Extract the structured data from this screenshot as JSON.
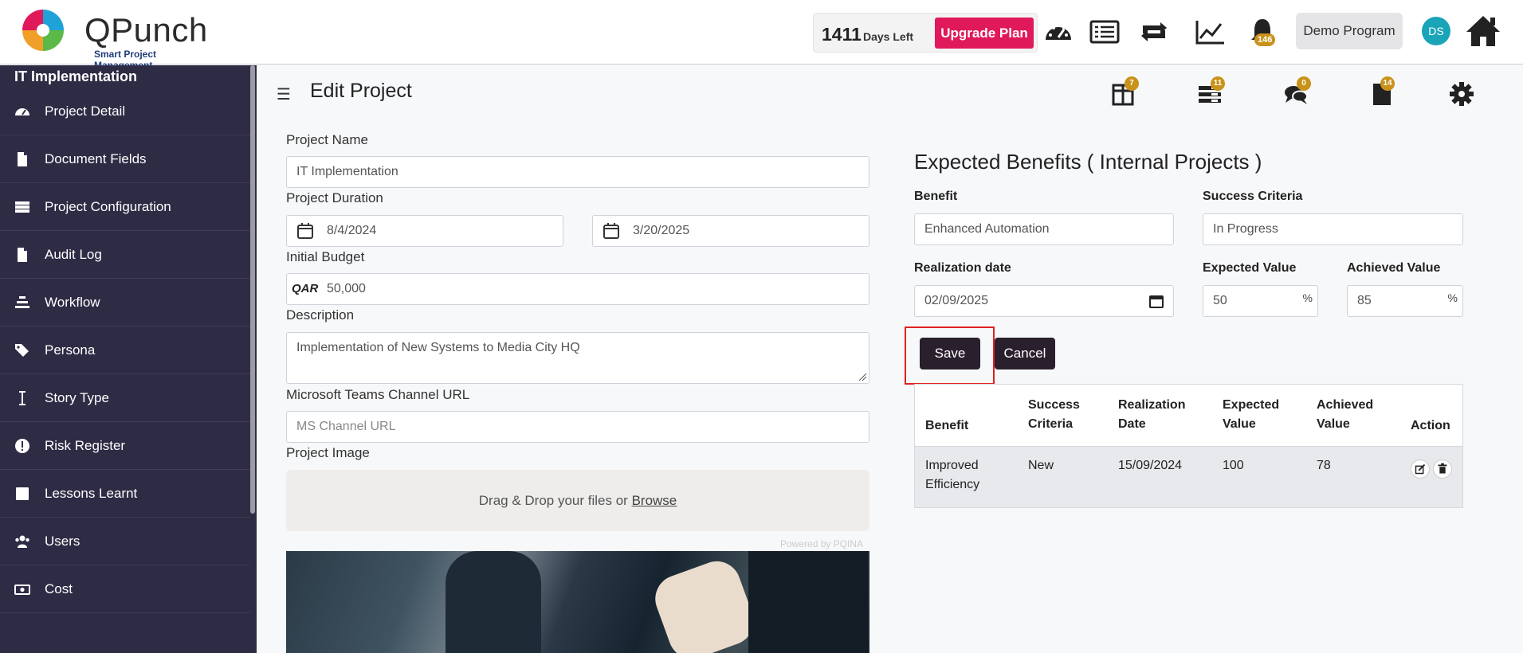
{
  "brand": {
    "name": "QPunch",
    "tagline": "Smart Project Management",
    "colors": {
      "red": "#e0195a",
      "green": "#5bb947",
      "blue": "#1fa2d8",
      "orange": "#f0a029"
    }
  },
  "topbar": {
    "days_left_number": "1411",
    "days_left_label": "Days Left",
    "upgrade_label": "Upgrade Plan",
    "notifications_count": "146",
    "program_label": "Demo Program",
    "avatar_initials": "DS"
  },
  "sidebar": {
    "title": "IT Implementation",
    "items": [
      {
        "label": "Project Detail",
        "icon": "dashboard-icon"
      },
      {
        "label": "Document Fields",
        "icon": "file-icon"
      },
      {
        "label": "Project Configuration",
        "icon": "server-icon"
      },
      {
        "label": "Audit Log",
        "icon": "file-icon"
      },
      {
        "label": "Workflow",
        "icon": "stack-icon"
      },
      {
        "label": "Persona",
        "icon": "tags-icon"
      },
      {
        "label": "Story Type",
        "icon": "text-cursor-icon"
      },
      {
        "label": "Risk Register",
        "icon": "exclamation-icon"
      },
      {
        "label": "Lessons Learnt",
        "icon": "square-icon"
      },
      {
        "label": "Users",
        "icon": "users-icon"
      },
      {
        "label": "Cost",
        "icon": "money-icon"
      }
    ]
  },
  "header": {
    "title": "Edit Project",
    "badges": {
      "board": "7",
      "backlog": "11",
      "comments": "0",
      "documents": "14"
    }
  },
  "form": {
    "project_name_label": "Project Name",
    "project_name_value": "IT Implementation",
    "duration_label": "Project Duration",
    "start_date": "8/4/2024",
    "end_date": "3/20/2025",
    "budget_label": "Initial Budget",
    "budget_currency": "QAR",
    "budget_value": "50,000",
    "description_label": "Description",
    "description_value": "Implementation of New Systems to Media City HQ",
    "teams_label": "Microsoft Teams Channel URL",
    "teams_placeholder": "MS Channel URL",
    "image_label": "Project Image",
    "dropzone_text": "Drag & Drop your files or",
    "dropzone_browse": "Browse",
    "powered_by": "Powered by PQINA"
  },
  "benefits": {
    "title": "Expected Benefits ( Internal Projects )",
    "benefit_label": "Benefit",
    "benefit_value": "Enhanced Automation",
    "criteria_label": "Success Criteria",
    "criteria_value": "In Progress",
    "realization_label": "Realization date",
    "realization_value": "02/09/2025",
    "expected_label": "Expected Value",
    "expected_value": "50",
    "achieved_label": "Achieved Value",
    "achieved_value": "85",
    "percent_sign": "%",
    "save_label": "Save",
    "cancel_label": "Cancel",
    "table": {
      "headers": [
        "Benefit",
        "Success Criteria",
        "Realization Date",
        "Expected Value",
        "Achieved Value",
        "Action"
      ],
      "rows": [
        {
          "benefit": "Improved Efficiency",
          "criteria": "New",
          "date": "15/09/2024",
          "expected": "100",
          "achieved": "78"
        }
      ]
    }
  }
}
